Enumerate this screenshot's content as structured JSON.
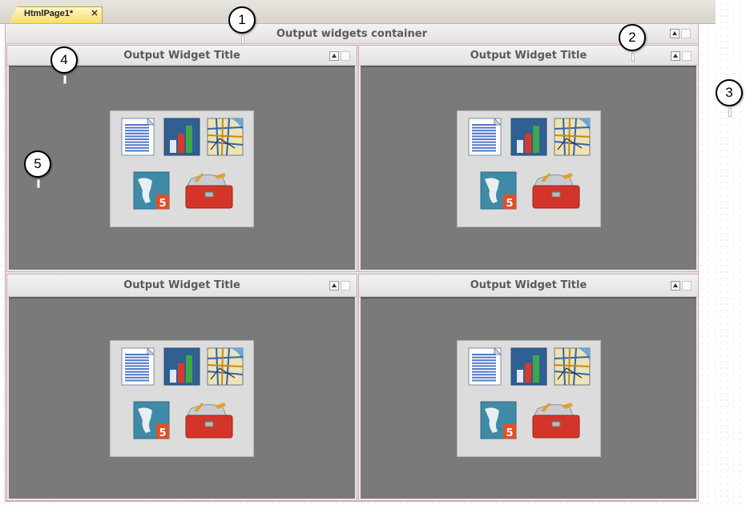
{
  "tab": {
    "label": "HtmlPage1*",
    "close_glyph": "×"
  },
  "container": {
    "title": "Output widgets container"
  },
  "widgets": [
    {
      "title": "Output Widget Title"
    },
    {
      "title": "Output Widget Title"
    },
    {
      "title": "Output Widget Title"
    },
    {
      "title": "Output Widget Title"
    }
  ],
  "widget_icons": [
    "document-icon",
    "bar-chart-icon",
    "map-icon",
    "html5-globe-icon",
    "toolbox-icon"
  ],
  "callouts": [
    "1",
    "2",
    "3",
    "4",
    "5"
  ],
  "colors": {
    "widget_body": "#7a7a7a",
    "container_border": "#d5a3c2",
    "tab_background": "#f7dc6c"
  }
}
